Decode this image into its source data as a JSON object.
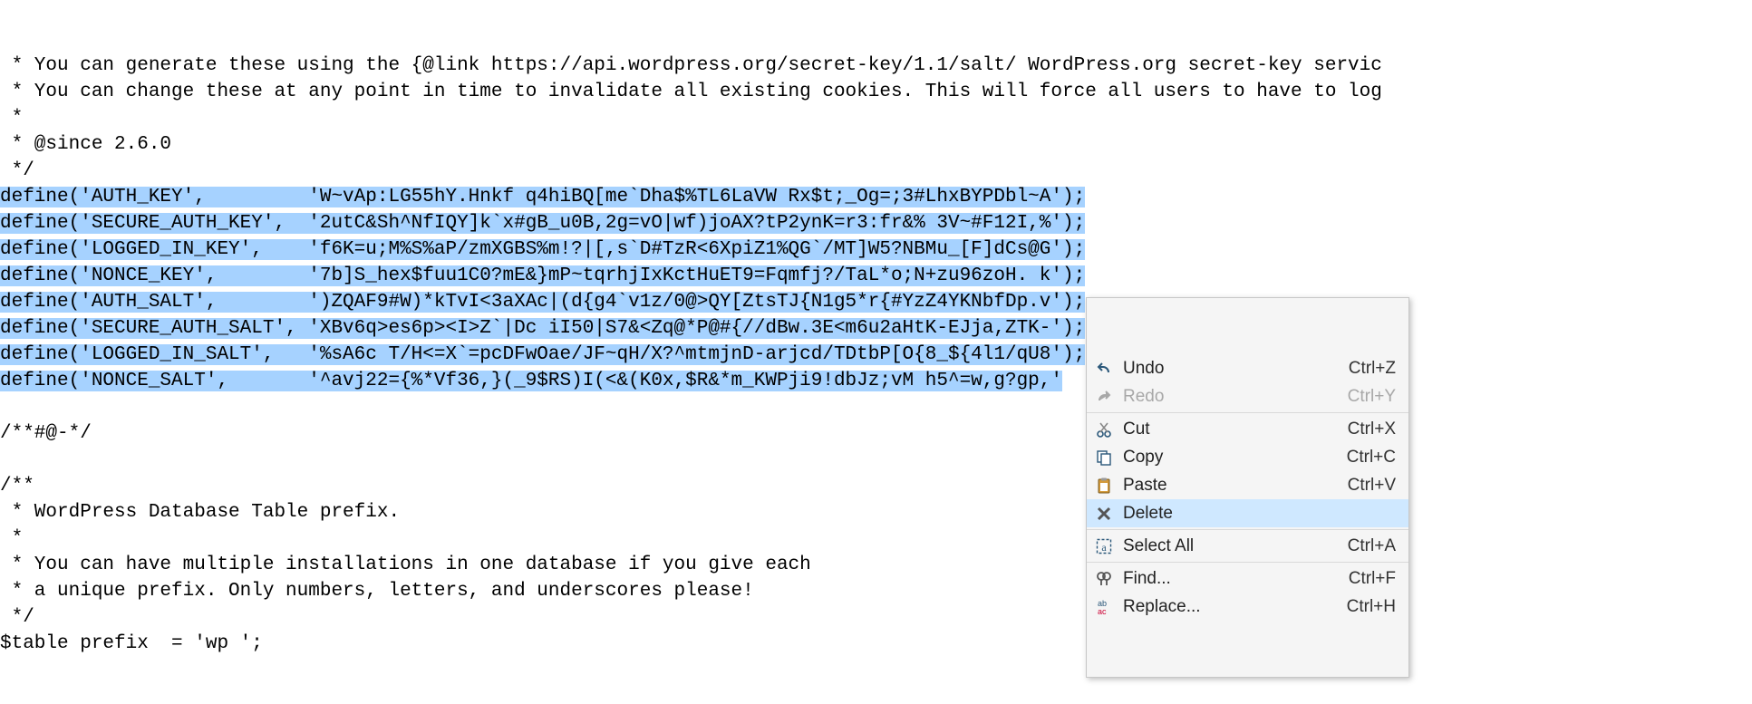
{
  "code": {
    "lines": [
      " * You can generate these using the {@link https://api.wordpress.org/secret-key/1.1/salt/ WordPress.org secret-key servic",
      " * You can change these at any point in time to invalidate all existing cookies. This will force all users to have to log",
      " *",
      " * @since 2.6.0",
      " */",
      "define('AUTH_KEY',         'W~vAp:LG55hY.Hnkf q4hiBQ[me`Dha$%TL6LaVW Rx$t;_Og=;3#LhxBYPDbl~A');",
      "define('SECURE_AUTH_KEY',  '2utC&Sh^NfIQY]k`x#gB_u0B,2g=vO|wf)joAX?tP2ynK=r3:fr&% 3V~#F12I,%');",
      "define('LOGGED_IN_KEY',    'f6K=u;M%S%aP/zmXGBS%m!?|[,s`D#TzR<6XpiZ1%QG`/MT]W5?NBMu_[F]dCs@G');",
      "define('NONCE_KEY',        '7b]S_hex$fuu1C0?mE&}mP~tqrhjIxKctHuET9=Fqmfj?/TaL*o;N+zu96zoH. k');",
      "define('AUTH_SALT',        ')ZQAF9#W)*kTvI<3aXAc|(d{g4`v1z/0@>QY[ZtsTJ{N1g5*r{#YzZ4YKNbfDp.v');",
      "define('SECURE_AUTH_SALT', 'XBv6q>es6p><I>Z`|Dc iI50|S7&<Zq@*P@#{//dBw.3E<m6u2aHtK-EJja,ZTK-');",
      "define('LOGGED_IN_SALT',   '%sA6c T/H<=X`=pcDFwOae/JF~qH/X?^mtmjnD-arjcd/TDtbP[O{8_${4l1/qU8');",
      "define('NONCE_SALT',       '^avj22={%*Vf36,}(_9$RS)I(<&(K0x,$R&*m_KWPji9!dbJz;vM h5^=w,g?gp,'",
      "",
      "/**#@-*/",
      "",
      "/**",
      " * WordPress Database Table prefix.",
      " *",
      " * You can have multiple installations in one database if you give each",
      " * a unique prefix. Only numbers, letters, and underscores please!",
      " */",
      "$table prefix  = 'wp ';"
    ],
    "selected_line_indices": [
      5,
      6,
      7,
      8,
      9,
      10,
      11,
      12
    ]
  },
  "context_menu": {
    "items": [
      {
        "label": "Undo",
        "shortcut": "Ctrl+Z",
        "icon": "undo-icon",
        "disabled": false
      },
      {
        "label": "Redo",
        "shortcut": "Ctrl+Y",
        "icon": "redo-icon",
        "disabled": true
      },
      {
        "sep": true
      },
      {
        "label": "Cut",
        "shortcut": "Ctrl+X",
        "icon": "cut-icon",
        "disabled": false
      },
      {
        "label": "Copy",
        "shortcut": "Ctrl+C",
        "icon": "copy-icon",
        "disabled": false
      },
      {
        "label": "Paste",
        "shortcut": "Ctrl+V",
        "icon": "paste-icon",
        "disabled": false
      },
      {
        "label": "Delete",
        "shortcut": "",
        "icon": "delete-icon",
        "disabled": false,
        "hover": true
      },
      {
        "sep": true
      },
      {
        "label": "Select All",
        "shortcut": "Ctrl+A",
        "icon": "select-all-icon",
        "disabled": false
      },
      {
        "sep": true
      },
      {
        "label": "Find...",
        "shortcut": "Ctrl+F",
        "icon": "find-icon",
        "disabled": false
      },
      {
        "label": "Replace...",
        "shortcut": "Ctrl+H",
        "icon": "replace-icon",
        "disabled": false
      }
    ]
  }
}
